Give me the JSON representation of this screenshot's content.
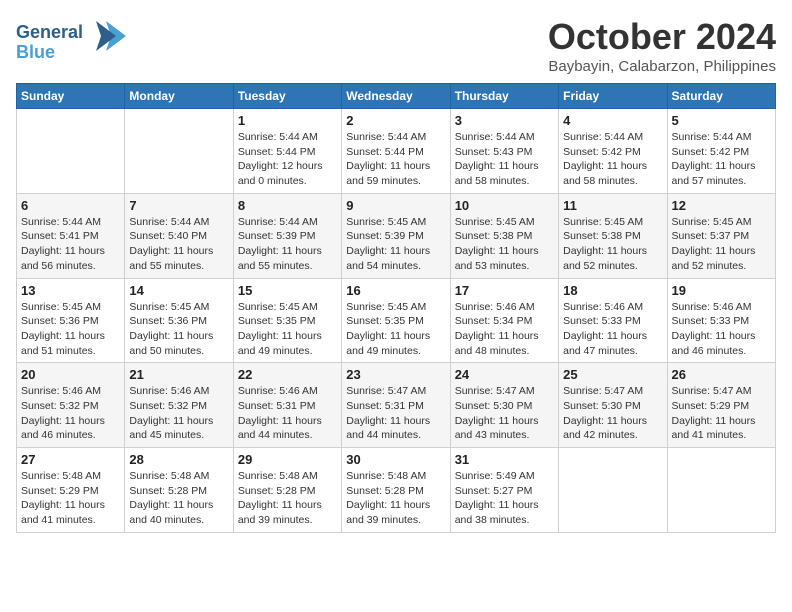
{
  "header": {
    "logo_line1": "General",
    "logo_line2": "Blue",
    "month": "October 2024",
    "location": "Baybayin, Calabarzon, Philippines"
  },
  "columns": [
    "Sunday",
    "Monday",
    "Tuesday",
    "Wednesday",
    "Thursday",
    "Friday",
    "Saturday"
  ],
  "weeks": [
    [
      {
        "day": "",
        "detail": ""
      },
      {
        "day": "",
        "detail": ""
      },
      {
        "day": "1",
        "detail": "Sunrise: 5:44 AM\nSunset: 5:44 PM\nDaylight: 12 hours\nand 0 minutes."
      },
      {
        "day": "2",
        "detail": "Sunrise: 5:44 AM\nSunset: 5:44 PM\nDaylight: 11 hours\nand 59 minutes."
      },
      {
        "day": "3",
        "detail": "Sunrise: 5:44 AM\nSunset: 5:43 PM\nDaylight: 11 hours\nand 58 minutes."
      },
      {
        "day": "4",
        "detail": "Sunrise: 5:44 AM\nSunset: 5:42 PM\nDaylight: 11 hours\nand 58 minutes."
      },
      {
        "day": "5",
        "detail": "Sunrise: 5:44 AM\nSunset: 5:42 PM\nDaylight: 11 hours\nand 57 minutes."
      }
    ],
    [
      {
        "day": "6",
        "detail": "Sunrise: 5:44 AM\nSunset: 5:41 PM\nDaylight: 11 hours\nand 56 minutes."
      },
      {
        "day": "7",
        "detail": "Sunrise: 5:44 AM\nSunset: 5:40 PM\nDaylight: 11 hours\nand 55 minutes."
      },
      {
        "day": "8",
        "detail": "Sunrise: 5:44 AM\nSunset: 5:39 PM\nDaylight: 11 hours\nand 55 minutes."
      },
      {
        "day": "9",
        "detail": "Sunrise: 5:45 AM\nSunset: 5:39 PM\nDaylight: 11 hours\nand 54 minutes."
      },
      {
        "day": "10",
        "detail": "Sunrise: 5:45 AM\nSunset: 5:38 PM\nDaylight: 11 hours\nand 53 minutes."
      },
      {
        "day": "11",
        "detail": "Sunrise: 5:45 AM\nSunset: 5:38 PM\nDaylight: 11 hours\nand 52 minutes."
      },
      {
        "day": "12",
        "detail": "Sunrise: 5:45 AM\nSunset: 5:37 PM\nDaylight: 11 hours\nand 52 minutes."
      }
    ],
    [
      {
        "day": "13",
        "detail": "Sunrise: 5:45 AM\nSunset: 5:36 PM\nDaylight: 11 hours\nand 51 minutes."
      },
      {
        "day": "14",
        "detail": "Sunrise: 5:45 AM\nSunset: 5:36 PM\nDaylight: 11 hours\nand 50 minutes."
      },
      {
        "day": "15",
        "detail": "Sunrise: 5:45 AM\nSunset: 5:35 PM\nDaylight: 11 hours\nand 49 minutes."
      },
      {
        "day": "16",
        "detail": "Sunrise: 5:45 AM\nSunset: 5:35 PM\nDaylight: 11 hours\nand 49 minutes."
      },
      {
        "day": "17",
        "detail": "Sunrise: 5:46 AM\nSunset: 5:34 PM\nDaylight: 11 hours\nand 48 minutes."
      },
      {
        "day": "18",
        "detail": "Sunrise: 5:46 AM\nSunset: 5:33 PM\nDaylight: 11 hours\nand 47 minutes."
      },
      {
        "day": "19",
        "detail": "Sunrise: 5:46 AM\nSunset: 5:33 PM\nDaylight: 11 hours\nand 46 minutes."
      }
    ],
    [
      {
        "day": "20",
        "detail": "Sunrise: 5:46 AM\nSunset: 5:32 PM\nDaylight: 11 hours\nand 46 minutes."
      },
      {
        "day": "21",
        "detail": "Sunrise: 5:46 AM\nSunset: 5:32 PM\nDaylight: 11 hours\nand 45 minutes."
      },
      {
        "day": "22",
        "detail": "Sunrise: 5:46 AM\nSunset: 5:31 PM\nDaylight: 11 hours\nand 44 minutes."
      },
      {
        "day": "23",
        "detail": "Sunrise: 5:47 AM\nSunset: 5:31 PM\nDaylight: 11 hours\nand 44 minutes."
      },
      {
        "day": "24",
        "detail": "Sunrise: 5:47 AM\nSunset: 5:30 PM\nDaylight: 11 hours\nand 43 minutes."
      },
      {
        "day": "25",
        "detail": "Sunrise: 5:47 AM\nSunset: 5:30 PM\nDaylight: 11 hours\nand 42 minutes."
      },
      {
        "day": "26",
        "detail": "Sunrise: 5:47 AM\nSunset: 5:29 PM\nDaylight: 11 hours\nand 41 minutes."
      }
    ],
    [
      {
        "day": "27",
        "detail": "Sunrise: 5:48 AM\nSunset: 5:29 PM\nDaylight: 11 hours\nand 41 minutes."
      },
      {
        "day": "28",
        "detail": "Sunrise: 5:48 AM\nSunset: 5:28 PM\nDaylight: 11 hours\nand 40 minutes."
      },
      {
        "day": "29",
        "detail": "Sunrise: 5:48 AM\nSunset: 5:28 PM\nDaylight: 11 hours\nand 39 minutes."
      },
      {
        "day": "30",
        "detail": "Sunrise: 5:48 AM\nSunset: 5:28 PM\nDaylight: 11 hours\nand 39 minutes."
      },
      {
        "day": "31",
        "detail": "Sunrise: 5:49 AM\nSunset: 5:27 PM\nDaylight: 11 hours\nand 38 minutes."
      },
      {
        "day": "",
        "detail": ""
      },
      {
        "day": "",
        "detail": ""
      }
    ]
  ]
}
